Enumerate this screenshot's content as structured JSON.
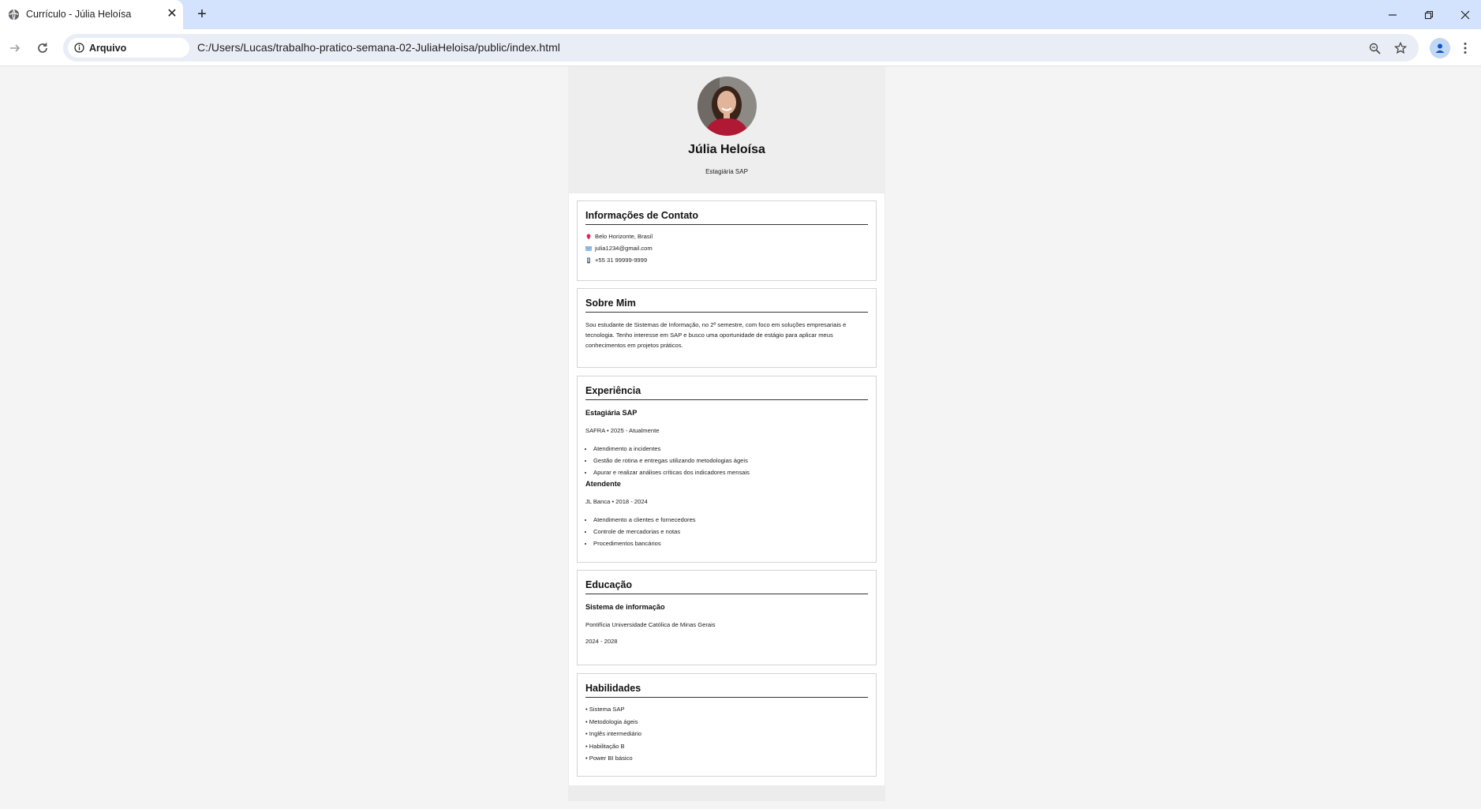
{
  "browser": {
    "tab_title": "Currículo - Júlia Heloísa",
    "site_info_label": "Arquivo",
    "url": "C:/Users/Lucas/trabalho-pratico-semana-02-JuliaHeloisa/public/index.html"
  },
  "profile": {
    "name": "Júlia Heloísa",
    "role": "Estagiária SAP"
  },
  "contact": {
    "title": "Informações de Contato",
    "items": [
      {
        "icon": "pin-icon",
        "text": "Belo Horizonte, Brasil"
      },
      {
        "icon": "mail-icon",
        "text": "julia1234@gmail.com"
      },
      {
        "icon": "phone-icon",
        "text": "+55 31 99999-9999"
      }
    ]
  },
  "about": {
    "title": "Sobre Mim",
    "text": "Sou estudante de Sistemas de Informação, no 2º semestre, com foco em soluções empresariais e tecnologia. Tenho interesse em SAP e busco uma oportunidade de estágio para aplicar meus conhecimentos em projetos práticos."
  },
  "experience": {
    "title": "Experiência",
    "jobs": [
      {
        "title": "Estagiária SAP",
        "meta": "SAFRA • 2025 - Atualmente",
        "items": [
          "Atendimento a incidentes",
          "Gestão de rotina e entregas utilizando metodologias ágeis",
          "Apurar e realizar análises críticas dos indicadores mensais"
        ]
      },
      {
        "title": "Atendente",
        "meta": "JL Banca • 2018 - 2024",
        "items": [
          "Atendimento a clientes e fornecedores",
          "Controle de mercadorias e notas",
          "Procedimentos bancários"
        ]
      }
    ]
  },
  "education": {
    "title": "Educação",
    "course": "Sistema de informação",
    "school": "Pontifícia Universidade Católica de Minas Gerais",
    "period": "2024 - 2028"
  },
  "skills": {
    "title": "Habilidades",
    "items": [
      "• Sistema SAP",
      "• Metodologia ágeis",
      "• Inglês intermediário",
      "• Habilitação B",
      "• Power BI básico"
    ]
  },
  "colors": {
    "tabbar": "#d3e3fd",
    "omnibox": "#e9eef6",
    "page_bg": "#f4f4f4"
  }
}
